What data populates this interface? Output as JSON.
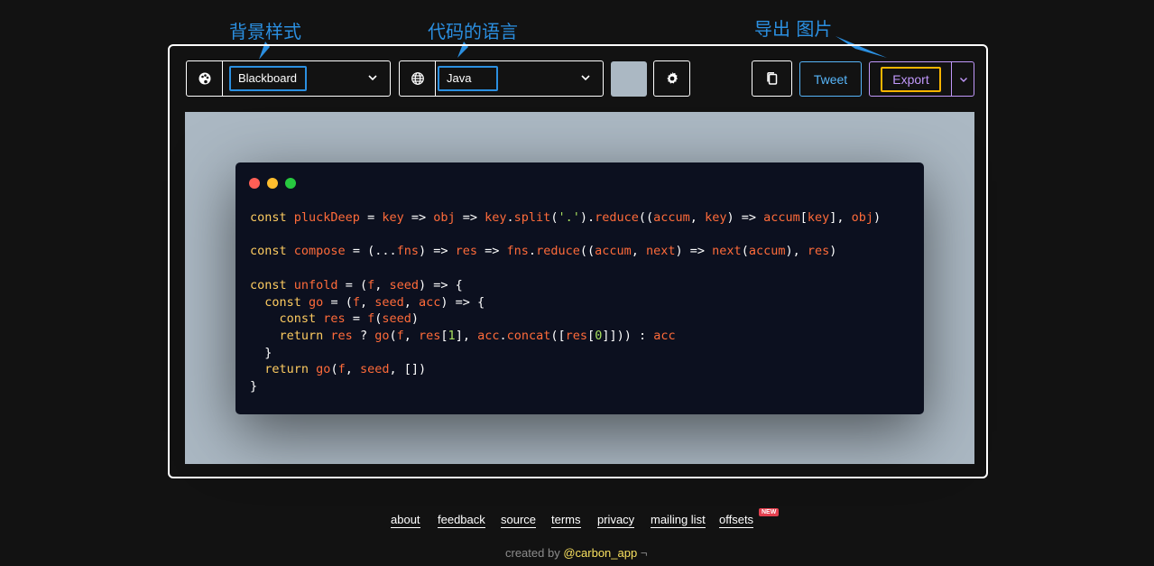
{
  "annotations": {
    "background_style": "背景样式",
    "code_language": "代码的语言",
    "export_image": "导出 图片"
  },
  "toolbar": {
    "theme_value": "Blackboard",
    "theme_icon": "palette-icon",
    "language_value": "Java",
    "language_icon": "globe-icon",
    "background_color": "#abb8c3",
    "settings_icon": "gear-icon",
    "copy_icon": "copy-icon",
    "tweet_label": "Tweet",
    "export_label": "Export"
  },
  "colors": {
    "tweet": "#57b5f9",
    "export_border": "#c198fb",
    "export_highlight": "#f8b500",
    "annotation": "#2b8fe0"
  },
  "window_controls": [
    "#ff5f56",
    "#ffbd2e",
    "#27c93f"
  ],
  "code_lines": [
    [
      [
        "kw",
        "const "
      ],
      [
        "fn",
        "pluckDeep"
      ],
      [
        "pl",
        " = "
      ],
      [
        "fn",
        "key"
      ],
      [
        "pl",
        " => "
      ],
      [
        "fn",
        "obj"
      ],
      [
        "pl",
        " => "
      ],
      [
        "fn",
        "key"
      ],
      [
        "pl",
        "."
      ],
      [
        "fn",
        "split"
      ],
      [
        "pl",
        "("
      ],
      [
        "st",
        "'.'"
      ],
      [
        "pl",
        ")."
      ],
      [
        "fn",
        "reduce"
      ],
      [
        "pl",
        "(("
      ],
      [
        "fn",
        "accum"
      ],
      [
        "pl",
        ", "
      ],
      [
        "fn",
        "key"
      ],
      [
        "pl",
        ") => "
      ],
      [
        "fn",
        "accum"
      ],
      [
        "pl",
        "["
      ],
      [
        "fn",
        "key"
      ],
      [
        "pl",
        "], "
      ],
      [
        "fn",
        "obj"
      ],
      [
        "pl",
        ")"
      ]
    ],
    [],
    [
      [
        "kw",
        "const "
      ],
      [
        "fn",
        "compose"
      ],
      [
        "pl",
        " = (..."
      ],
      [
        "fn",
        "fns"
      ],
      [
        "pl",
        ") => "
      ],
      [
        "fn",
        "res"
      ],
      [
        "pl",
        " => "
      ],
      [
        "fn",
        "fns"
      ],
      [
        "pl",
        "."
      ],
      [
        "fn",
        "reduce"
      ],
      [
        "pl",
        "(("
      ],
      [
        "fn",
        "accum"
      ],
      [
        "pl",
        ", "
      ],
      [
        "fn",
        "next"
      ],
      [
        "pl",
        ") => "
      ],
      [
        "fn",
        "next"
      ],
      [
        "pl",
        "("
      ],
      [
        "fn",
        "accum"
      ],
      [
        "pl",
        "), "
      ],
      [
        "fn",
        "res"
      ],
      [
        "pl",
        ")"
      ]
    ],
    [],
    [
      [
        "kw",
        "const "
      ],
      [
        "fn",
        "unfold"
      ],
      [
        "pl",
        " = ("
      ],
      [
        "fn",
        "f"
      ],
      [
        "pl",
        ", "
      ],
      [
        "fn",
        "seed"
      ],
      [
        "pl",
        ") => {"
      ]
    ],
    [
      [
        "pl",
        "  "
      ],
      [
        "kw",
        "const "
      ],
      [
        "fn",
        "go"
      ],
      [
        "pl",
        " = ("
      ],
      [
        "fn",
        "f"
      ],
      [
        "pl",
        ", "
      ],
      [
        "fn",
        "seed"
      ],
      [
        "pl",
        ", "
      ],
      [
        "fn",
        "acc"
      ],
      [
        "pl",
        ") => {"
      ]
    ],
    [
      [
        "pl",
        "    "
      ],
      [
        "kw",
        "const "
      ],
      [
        "fn",
        "res"
      ],
      [
        "pl",
        " = "
      ],
      [
        "fn",
        "f"
      ],
      [
        "pl",
        "("
      ],
      [
        "fn",
        "seed"
      ],
      [
        "pl",
        ")"
      ]
    ],
    [
      [
        "pl",
        "    "
      ],
      [
        "kw",
        "return "
      ],
      [
        "fn",
        "res"
      ],
      [
        "pl",
        " ? "
      ],
      [
        "fn",
        "go"
      ],
      [
        "pl",
        "("
      ],
      [
        "fn",
        "f"
      ],
      [
        "pl",
        ", "
      ],
      [
        "fn",
        "res"
      ],
      [
        "pl",
        "["
      ],
      [
        "st",
        "1"
      ],
      [
        "pl",
        "], "
      ],
      [
        "fn",
        "acc"
      ],
      [
        "pl",
        "."
      ],
      [
        "fn",
        "concat"
      ],
      [
        "pl",
        "(["
      ],
      [
        "fn",
        "res"
      ],
      [
        "pl",
        "["
      ],
      [
        "st",
        "0"
      ],
      [
        "pl",
        "]])) : "
      ],
      [
        "fn",
        "acc"
      ]
    ],
    [
      [
        "pl",
        "  }"
      ]
    ],
    [
      [
        "pl",
        "  "
      ],
      [
        "kw",
        "return "
      ],
      [
        "fn",
        "go"
      ],
      [
        "pl",
        "("
      ],
      [
        "fn",
        "f"
      ],
      [
        "pl",
        ", "
      ],
      [
        "fn",
        "seed"
      ],
      [
        "pl",
        ", [])"
      ]
    ],
    [
      [
        "pl",
        "}"
      ]
    ]
  ],
  "footer": {
    "links": [
      "about",
      "feedback",
      "source",
      "terms",
      "privacy",
      "mailing list",
      "offsets"
    ],
    "badge": "NEW",
    "credit_prefix": "created by ",
    "credit_handle": "@carbon_app",
    "credit_suffix": " ¬"
  }
}
